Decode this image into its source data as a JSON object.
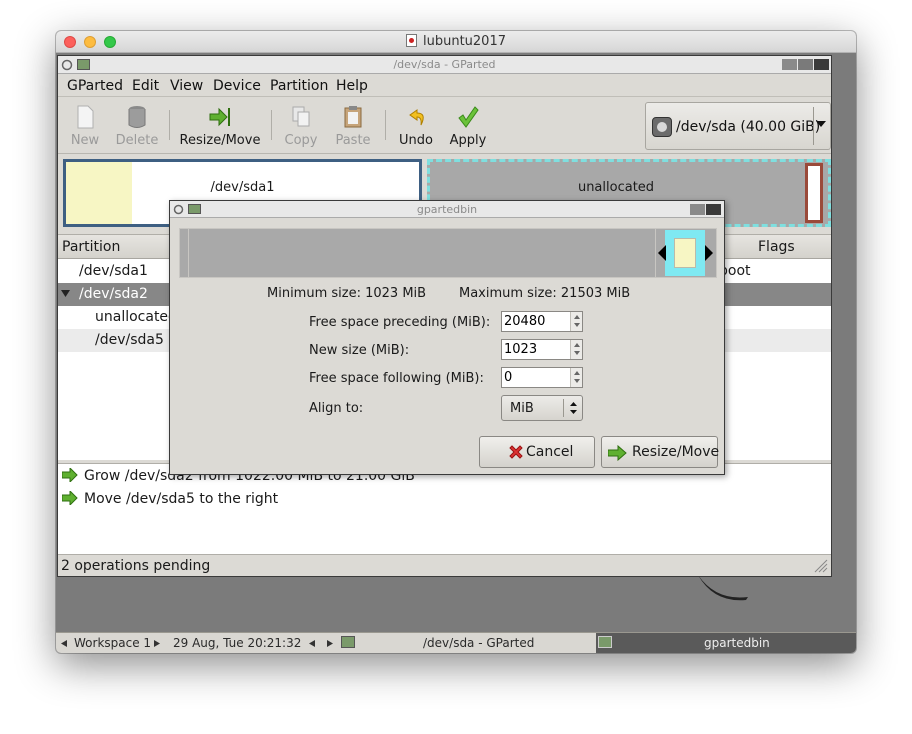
{
  "mac_window": {
    "title": "lubuntu2017",
    "traffic_colors": {
      "close": "#fc605c",
      "minimize": "#fdbc40",
      "zoom": "#34c84a"
    }
  },
  "gparted": {
    "title": "/dev/sda - GParted",
    "menu": [
      "GParted",
      "Edit",
      "View",
      "Device",
      "Partition",
      "Help"
    ],
    "toolbar": {
      "new": "New",
      "delete": "Delete",
      "resize_move": "Resize/Move",
      "copy": "Copy",
      "paste": "Paste",
      "undo": "Undo",
      "apply": "Apply"
    },
    "device_selector": "/dev/sda  (40.00 GiB)",
    "graph": {
      "sda1_label": "/dev/sda1",
      "unallocated_label": "unallocated"
    },
    "list": {
      "header_partition": "Partition",
      "header_flags": "Flags",
      "rows": [
        {
          "name": "/dev/sda1",
          "flags": "boot"
        },
        {
          "name": "/dev/sda2",
          "flags": ""
        },
        {
          "name": "unallocated",
          "flags": ""
        },
        {
          "name": "/dev/sda5",
          "flags": ""
        }
      ]
    },
    "operations": [
      "Grow /dev/sda2 from 1022.00 MiB to 21.00 GiB",
      "Move /dev/sda5 to the right"
    ],
    "status": "2 operations pending"
  },
  "dialog": {
    "title": "gpartedbin",
    "min_size": "Minimum size: 1023 MiB",
    "max_size": "Maximum size: 21503 MiB",
    "free_preceding_label": "Free space preceding (MiB):",
    "free_preceding_value": "20480",
    "new_size_label": "New size (MiB):",
    "new_size_value": "1023",
    "free_following_label": "Free space following (MiB):",
    "free_following_value": "0",
    "align_label": "Align to:",
    "align_value": "MiB",
    "cancel": "Cancel",
    "resize_move": "Resize/Move"
  },
  "taskbar": {
    "workspace": "Workspace 1",
    "datetime": "29 Aug, Tue 20:21:32",
    "task_gparted": "/dev/sda - GParted",
    "task_gpartedbin": "gpartedbin"
  },
  "colors": {
    "selection": "#878787",
    "partition_border": "#3e5f82",
    "extended_border": "#7fdfdf",
    "logical_border": "#9a4a3a",
    "used_space": "#f7f6c4",
    "resizer_highlight": "#7fe9f2",
    "apply_green": "#5fb030",
    "cancel_red": "#d33"
  }
}
